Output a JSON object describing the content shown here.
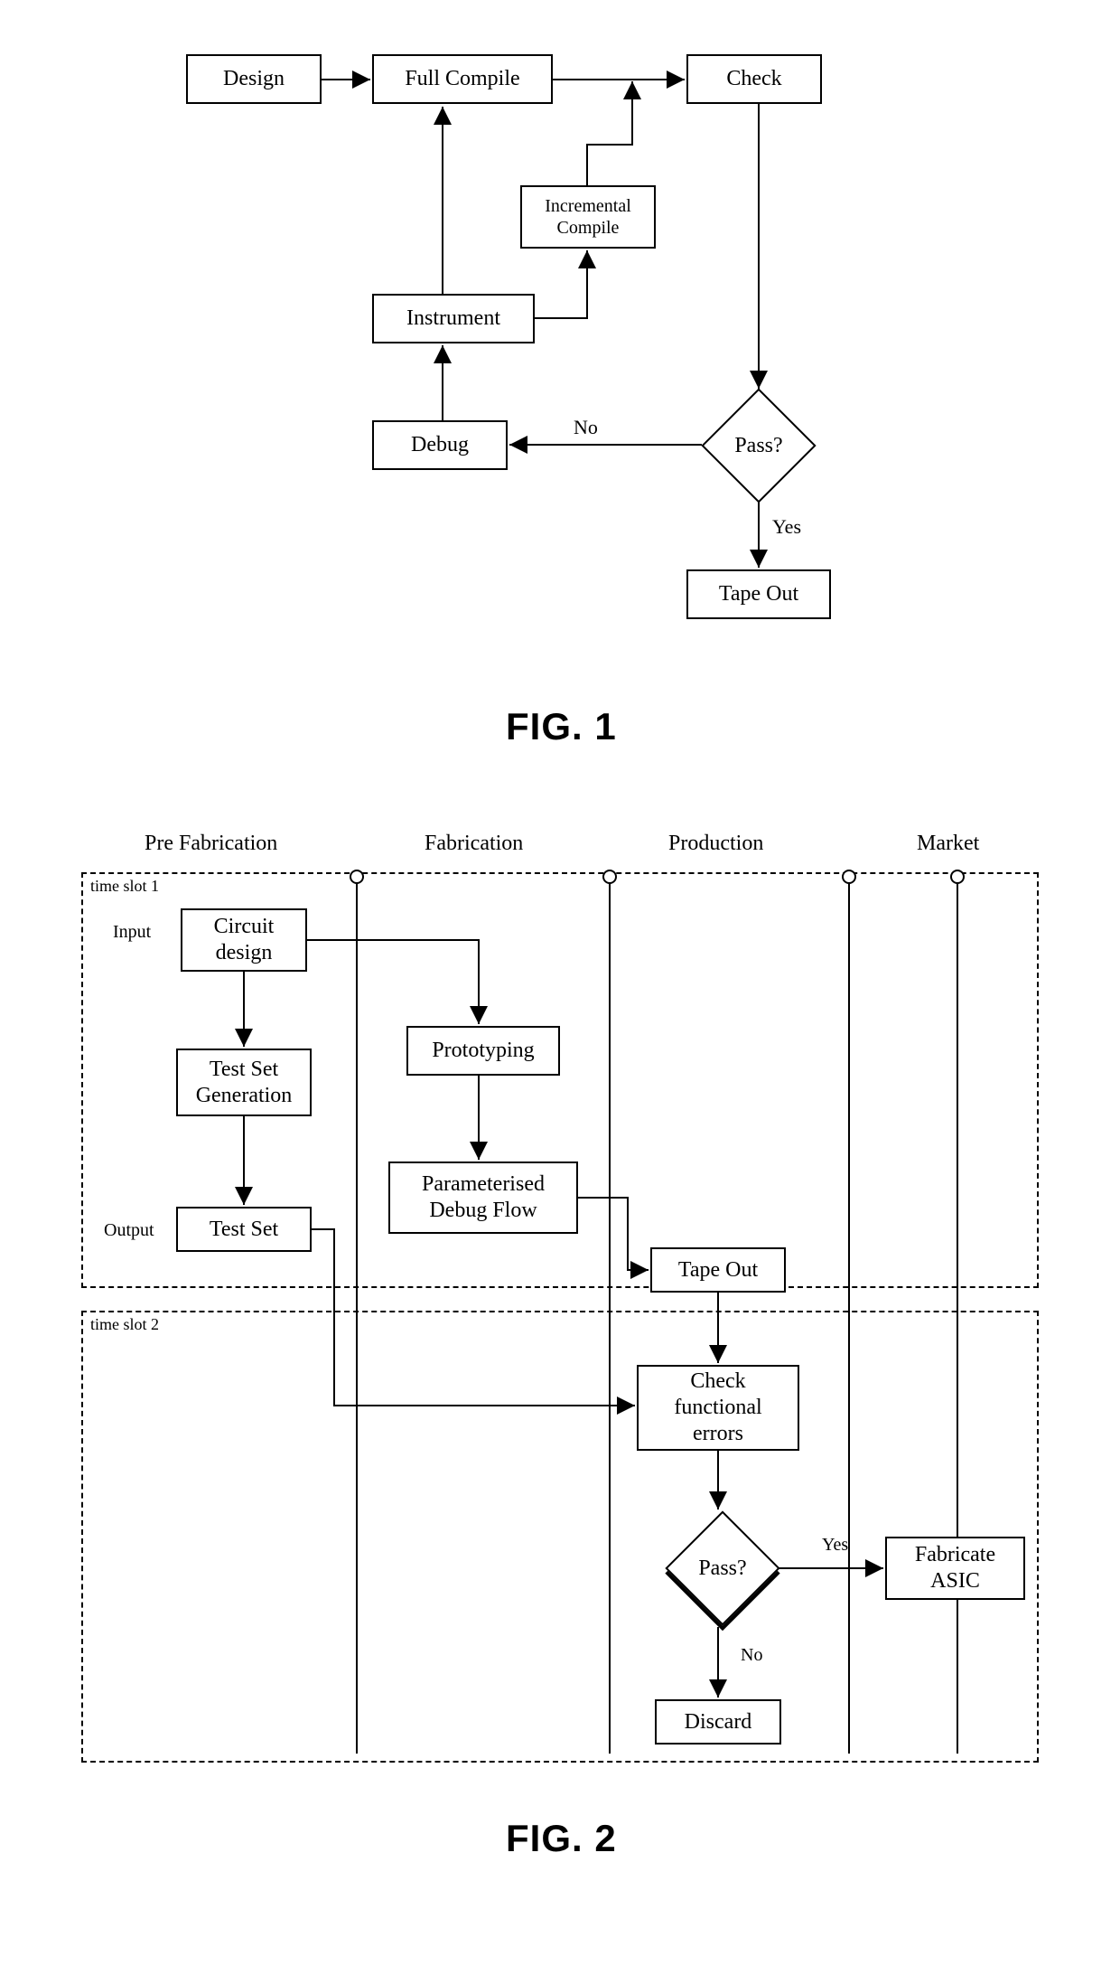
{
  "fig1": {
    "caption": "FIG. 1",
    "boxes": {
      "design": "Design",
      "full_compile": "Full Compile",
      "check": "Check",
      "incremental_compile": "Incremental\nCompile",
      "instrument": "Instrument",
      "debug": "Debug",
      "tape_out": "Tape Out"
    },
    "decision": {
      "pass": "Pass?"
    },
    "edge_labels": {
      "no": "No",
      "yes": "Yes"
    }
  },
  "fig2": {
    "caption": "FIG. 2",
    "lanes": {
      "pre_fabrication": "Pre Fabrication",
      "fabrication": "Fabrication",
      "production": "Production",
      "market": "Market"
    },
    "frames": {
      "slot1": "time slot 1",
      "slot2": "time slot 2"
    },
    "io_labels": {
      "input": "Input",
      "output": "Output"
    },
    "boxes": {
      "circuit_design": "Circuit\ndesign",
      "test_set_generation": "Test Set\nGeneration",
      "test_set": "Test Set",
      "prototyping": "Prototyping",
      "param_debug_flow": "Parameterised\nDebug Flow",
      "tape_out": "Tape Out",
      "check_functional_errors": "Check\nfunctional\nerrors",
      "fabricate_asic": "Fabricate\nASIC",
      "discard": "Discard"
    },
    "decision": {
      "pass": "Pass?"
    },
    "edge_labels": {
      "yes": "Yes",
      "no": "No"
    }
  }
}
